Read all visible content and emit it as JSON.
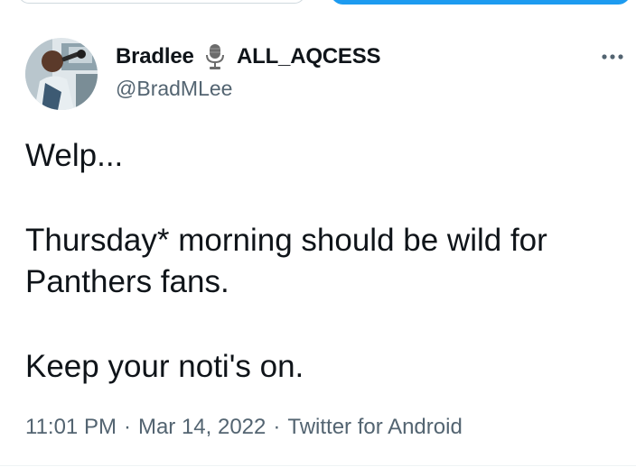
{
  "author": {
    "display_name": "Bradlee",
    "badge_icon": "microphone-icon",
    "name_suffix": "ALL_AQCESS",
    "handle": "@BradMLee"
  },
  "tweet": {
    "lines": [
      "Welp...",
      "Thursday* morning should be wild for",
      "Panthers fans.",
      "Keep your noti's on."
    ]
  },
  "meta": {
    "time": "11:01 PM",
    "date": "Mar 14, 2022",
    "source": "Twitter for Android",
    "separator": "·"
  },
  "colors": {
    "text_primary": "#0f1419",
    "text_secondary": "#536471",
    "accent": "#1d9bf0"
  }
}
